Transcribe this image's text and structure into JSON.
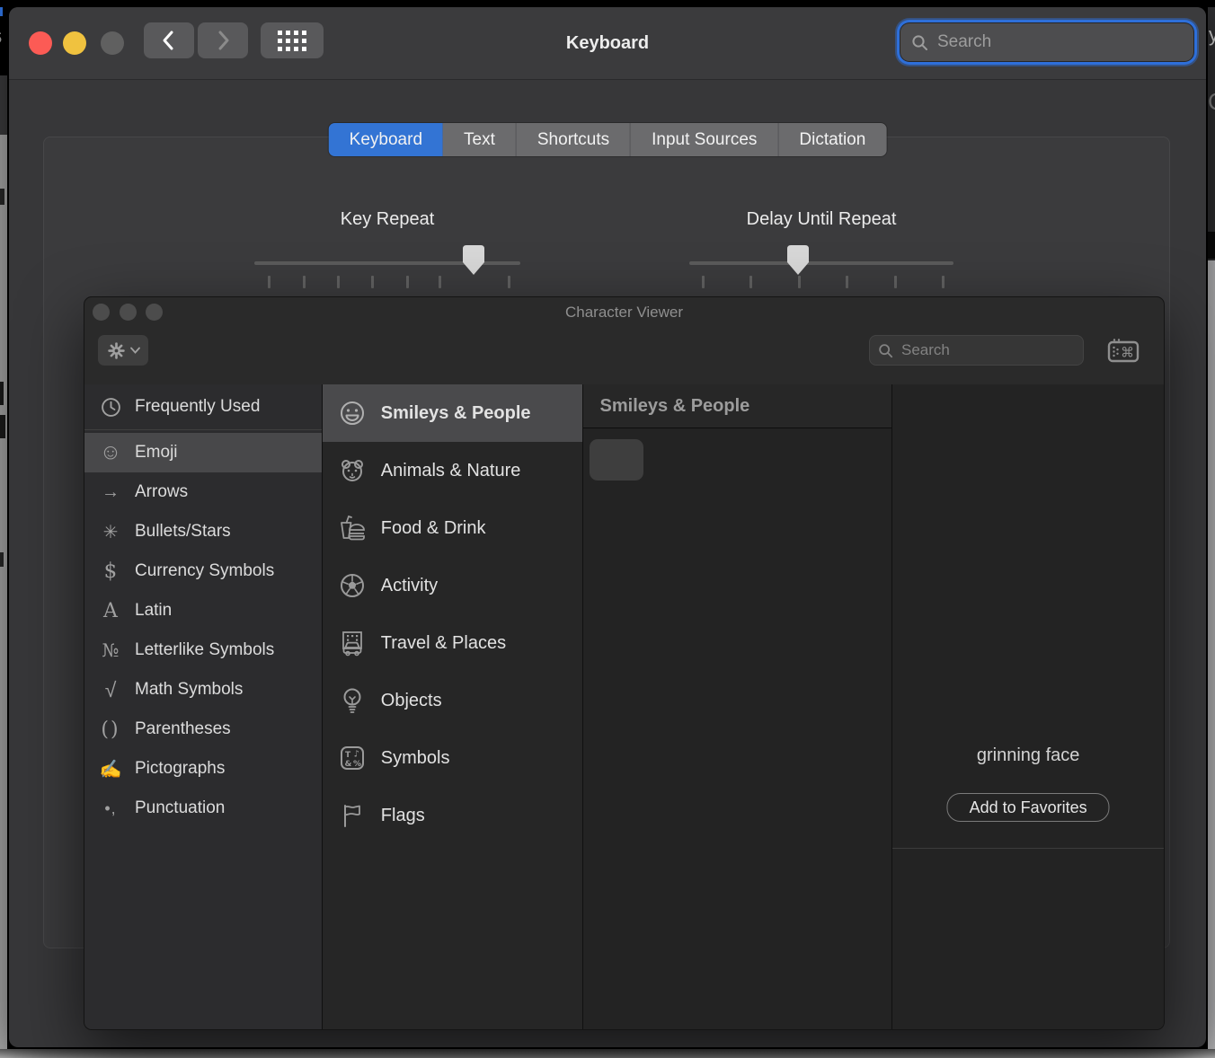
{
  "sp": {
    "title": "Keyboard",
    "search_placeholder": "Search",
    "tabs": [
      {
        "label": "Keyboard",
        "selected": true
      },
      {
        "label": "Text",
        "selected": false
      },
      {
        "label": "Shortcuts",
        "selected": false
      },
      {
        "label": "Input Sources",
        "selected": false
      },
      {
        "label": "Dictation",
        "selected": false
      }
    ],
    "sliders": {
      "key_repeat": {
        "label": "Key Repeat",
        "tick_count": 8,
        "thumb_tick_index": 6
      },
      "delay": {
        "label": "Delay Until Repeat",
        "tick_count": 6,
        "thumb_tick_index": 2
      }
    }
  },
  "cv": {
    "title": "Character Viewer",
    "search_placeholder": "Search",
    "toolbar_icons": [
      "gear-icon",
      "chevron-down-icon",
      "search-icon",
      "keyboard-viewer-icon"
    ],
    "sidebar": [
      {
        "icon": "clock-icon",
        "glyph": "",
        "label": "Frequently Used",
        "selected": false
      },
      {
        "icon": "smiley-icon",
        "glyph": "☺",
        "label": "Emoji",
        "selected": true
      },
      {
        "icon": "arrow-right-icon",
        "glyph": "→",
        "label": "Arrows",
        "selected": false
      },
      {
        "icon": "asterisk-icon",
        "glyph": "✳",
        "label": "Bullets/Stars",
        "selected": false
      },
      {
        "icon": "dollar-icon",
        "glyph": "$",
        "label": "Currency Symbols",
        "selected": false
      },
      {
        "icon": "letter-a-icon",
        "glyph": "A",
        "label": "Latin",
        "selected": false
      },
      {
        "icon": "numero-icon",
        "glyph": "№",
        "label": "Letterlike Symbols",
        "selected": false
      },
      {
        "icon": "radical-icon",
        "glyph": "√",
        "label": "Math Symbols",
        "selected": false
      },
      {
        "icon": "parentheses-icon",
        "glyph": "()",
        "label": "Parentheses",
        "selected": false
      },
      {
        "icon": "writing-hand-icon",
        "glyph": "✍",
        "label": "Pictographs",
        "selected": false
      },
      {
        "icon": "punctuation-icon",
        "glyph": "•,",
        "label": "Punctuation",
        "selected": false
      }
    ],
    "categories": [
      {
        "icon": "smiley-face-icon",
        "label": "Smileys & People",
        "selected": true
      },
      {
        "icon": "bear-icon",
        "label": "Animals & Nature",
        "selected": false
      },
      {
        "icon": "food-drink-icon",
        "label": "Food & Drink",
        "selected": false
      },
      {
        "icon": "soccer-ball-icon",
        "label": "Activity",
        "selected": false
      },
      {
        "icon": "travel-icon",
        "label": "Travel & Places",
        "selected": false
      },
      {
        "icon": "lightbulb-icon",
        "label": "Objects",
        "selected": false
      },
      {
        "icon": "symbols-icon",
        "label": "Symbols",
        "selected": false
      },
      {
        "icon": "flag-icon",
        "label": "Flags",
        "selected": false
      }
    ],
    "grid": {
      "header": "Smileys & People"
    },
    "detail": {
      "name": "grinning face",
      "favorites_button": "Add to Favorites"
    }
  },
  "colors": {
    "accent_blue": "#3374d4",
    "focus_ring": "#2e6fd9",
    "traffic_red": "#fc5b55",
    "traffic_yellow": "#f0c23f",
    "traffic_gray": "#606060",
    "window_bg": "#373739",
    "viewer_bg": "#2a2a2a"
  }
}
